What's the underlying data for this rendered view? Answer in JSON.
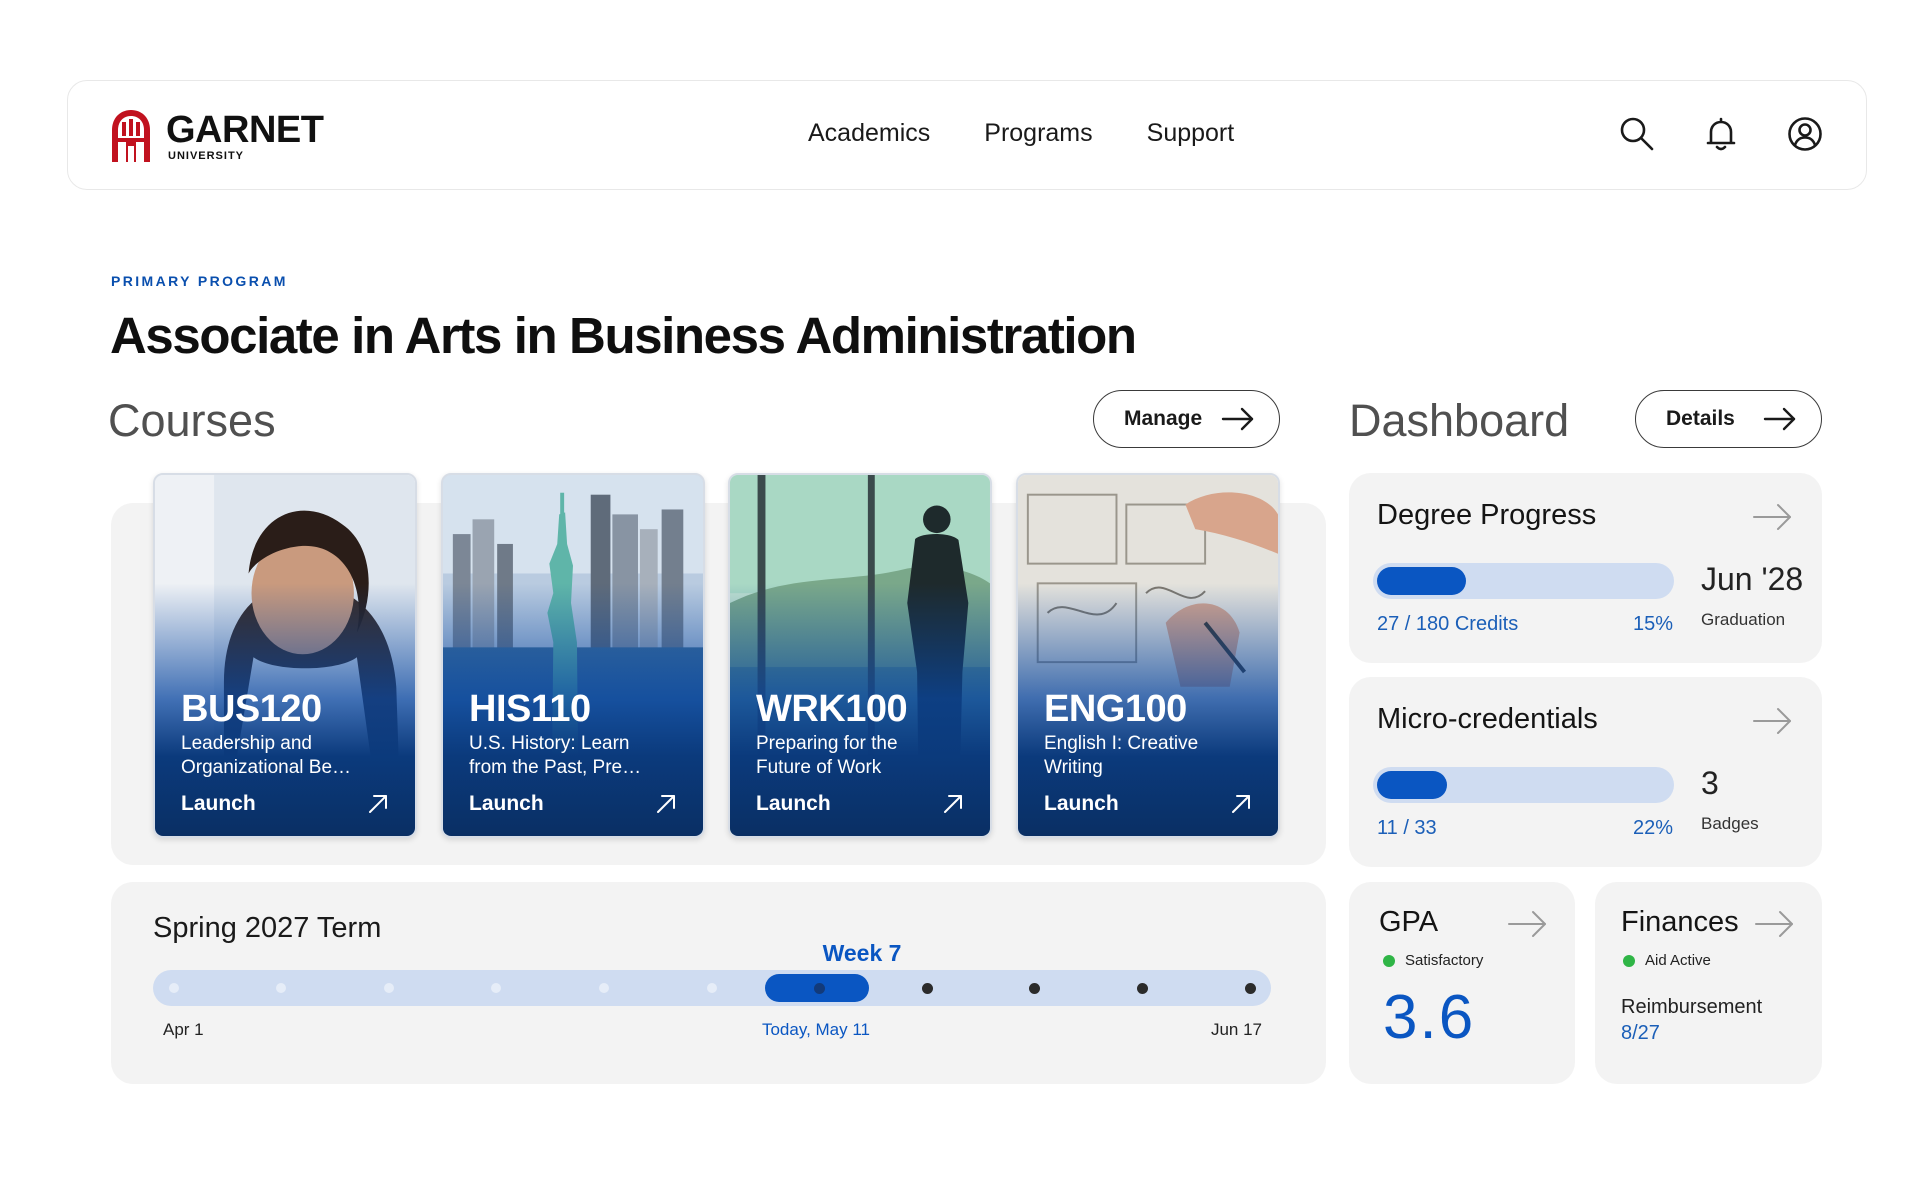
{
  "brand": {
    "name": "GARNET",
    "sub": "UNIVERSITY",
    "color": "#c1121f"
  },
  "nav": {
    "items": [
      {
        "label": "Academics"
      },
      {
        "label": "Programs"
      },
      {
        "label": "Support"
      }
    ]
  },
  "header_icons": [
    "search-icon",
    "bell-icon",
    "user-account-icon"
  ],
  "program": {
    "eyebrow": "PRIMARY PROGRAM",
    "title": "Associate in Arts in Business Administration"
  },
  "courses": {
    "title": "Courses",
    "manage_label": "Manage",
    "items": [
      {
        "code": "BUS120",
        "name": "Leadership and Organizational Be…",
        "action": "Launch"
      },
      {
        "code": "HIS110",
        "name": "U.S. History: Learn from the Past, Pre…",
        "action": "Launch"
      },
      {
        "code": "WRK100",
        "name": "Preparing for the Future of Work",
        "action": "Launch"
      },
      {
        "code": "ENG100",
        "name": "English I: Creative Writing",
        "action": "Launch"
      }
    ]
  },
  "term": {
    "title": "Spring 2027 Term",
    "current_week": "Week 7",
    "start_label": "Apr 1",
    "end_label": "Jun 17",
    "today_label": "Today, May 11",
    "current_week_index": 7,
    "total_weeks": 11
  },
  "dashboard": {
    "title": "Dashboard",
    "details_label": "Details",
    "degree": {
      "title": "Degree Progress",
      "progress_label": "27 / 180 Credits",
      "percent_label": "15%",
      "progress": 0.15,
      "big": "Jun '28",
      "sub": "Graduation"
    },
    "micro": {
      "title": "Micro-credentials",
      "progress_label": "11 / 33",
      "percent_label": "22%",
      "progress": 0.22,
      "big": "3",
      "sub": "Badges"
    },
    "gpa": {
      "title": "GPA",
      "status": "Satisfactory",
      "value": "3.6"
    },
    "finances": {
      "title": "Finances",
      "status": "Aid Active",
      "label": "Reimbursement",
      "value": "8/27"
    }
  },
  "colors": {
    "accent": "#0a56c2",
    "track": "#cfdcf1",
    "panel": "#f3f3f3",
    "status_green": "#2fb546"
  }
}
